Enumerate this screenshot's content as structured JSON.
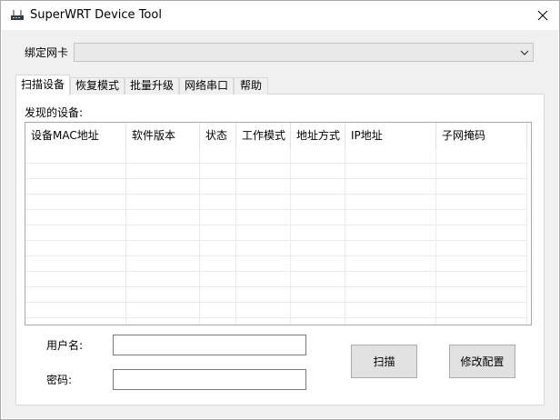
{
  "window": {
    "title": "SuperWRT Device Tool",
    "app_icon": "router-icon",
    "close_icon": "close-icon"
  },
  "nic": {
    "label": "绑定网卡",
    "selected_value": "",
    "dropdown_icon": "chevron-down-icon"
  },
  "tabs": [
    {
      "label": "扫描设备",
      "active": true
    },
    {
      "label": "恢复模式",
      "active": false
    },
    {
      "label": "批量升级",
      "active": false
    },
    {
      "label": "网络串口",
      "active": false
    },
    {
      "label": "帮助",
      "active": false
    }
  ],
  "scan": {
    "found_label": "发现的设备:",
    "columns": [
      "设备MAC地址",
      "软件版本",
      "状态",
      "工作模式",
      "地址方式",
      "IP地址",
      "子网掩码"
    ],
    "rows": [],
    "username_label": "用户名:",
    "username_value": "",
    "password_label": "密码:",
    "password_value": "",
    "scan_button": "扫描",
    "config_button": "修改配置"
  }
}
